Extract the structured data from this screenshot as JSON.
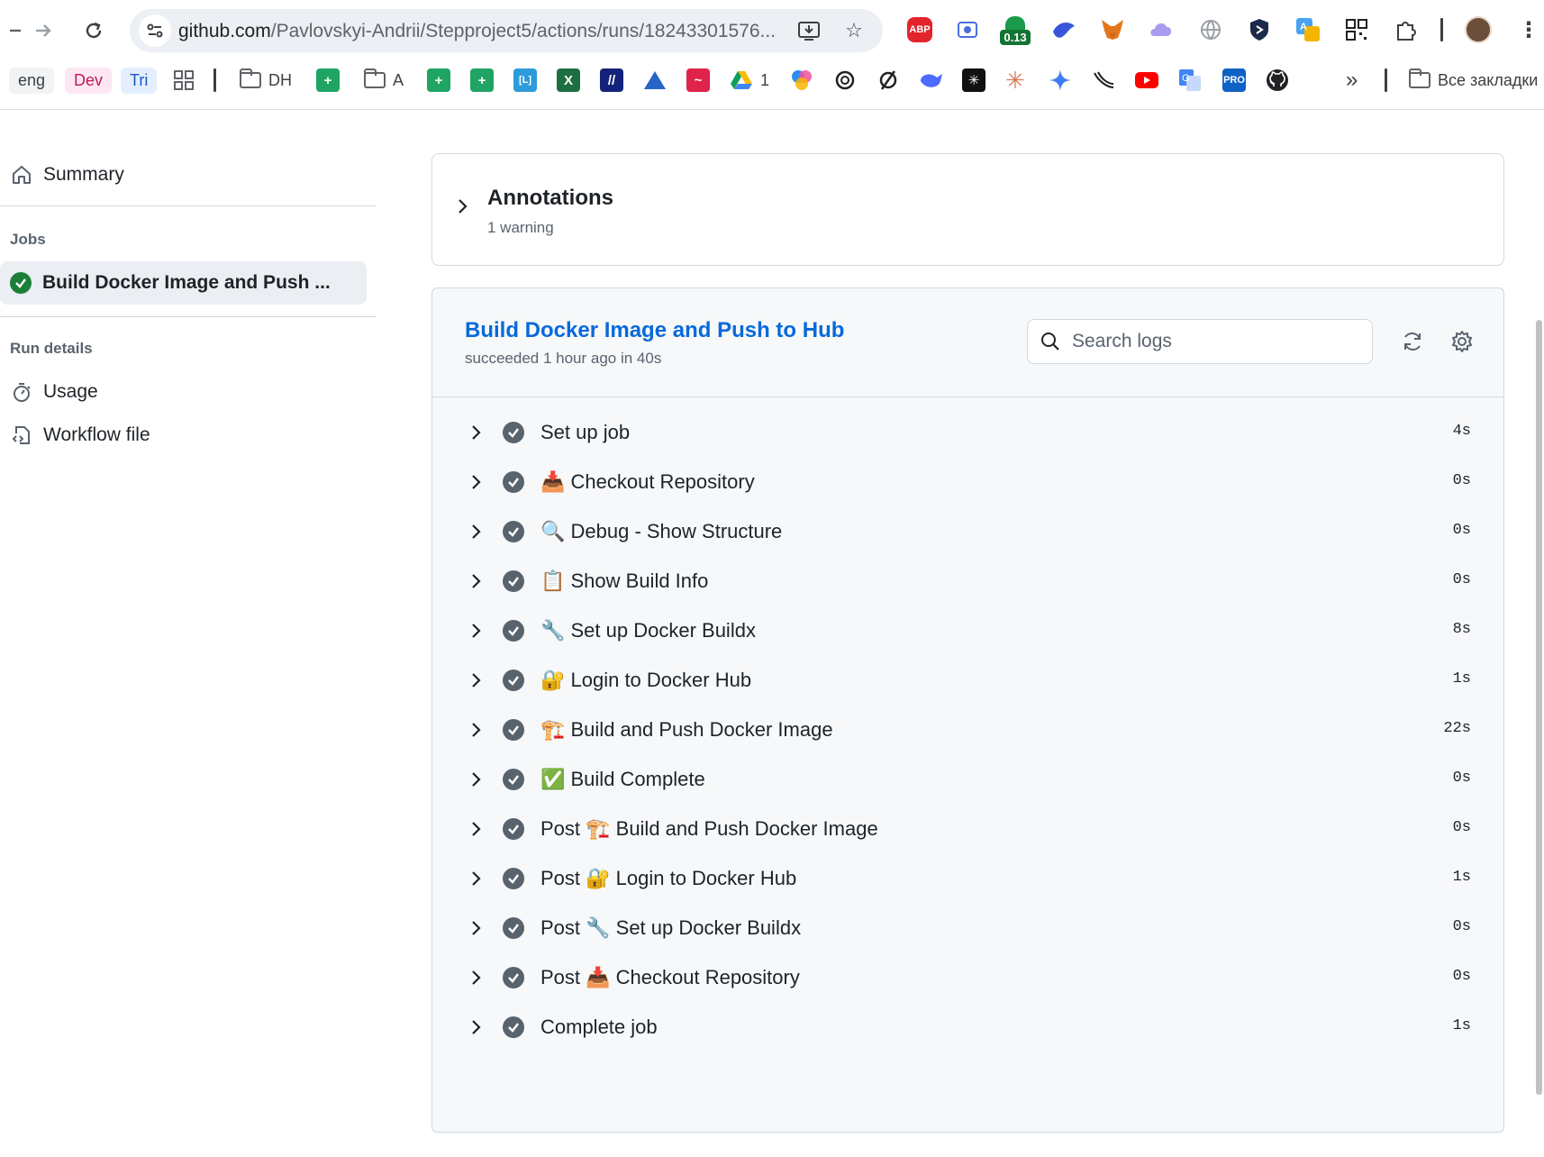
{
  "browser": {
    "url_host": "github.com",
    "url_path": "/Pavlovskyi-Andrii/Stepproject5/actions/runs/18243301576...",
    "extensions": [
      "abp-icon",
      "screen-capture-icon",
      "counter-badge-icon",
      "bird-icon",
      "metamask-fox-icon",
      "cloud-icon",
      "globe-icon",
      "shield-icon",
      "translate-icon",
      "qr-icon",
      "puzzle-icon"
    ],
    "ext_labels": {
      "abp": "ABP",
      "badge": "0.13"
    },
    "bookmarks": {
      "eng": "eng",
      "dev": "Dev",
      "tri": "Tri",
      "dh": "DH",
      "a": "A",
      "l": "[L]",
      "drive_count": "1",
      "pro": "PRO",
      "all_bookmarks": "Все закладки"
    }
  },
  "sidebar": {
    "summary": "Summary",
    "jobs_heading": "Jobs",
    "active_job": "Build Docker Image and Push ...",
    "run_details_heading": "Run details",
    "usage": "Usage",
    "workflow_file": "Workflow file"
  },
  "annotations": {
    "title": "Annotations",
    "subtitle": "1 warning"
  },
  "job": {
    "title": "Build Docker Image and Push to Hub",
    "subtitle": "succeeded 1 hour ago in 40s",
    "search_placeholder": "Search logs"
  },
  "steps": [
    {
      "name": "Set up job",
      "duration": "4s"
    },
    {
      "name": "📥 Checkout Repository",
      "duration": "0s"
    },
    {
      "name": "🔍 Debug - Show Structure",
      "duration": "0s"
    },
    {
      "name": "📋 Show Build Info",
      "duration": "0s"
    },
    {
      "name": "🔧 Set up Docker Buildx",
      "duration": "8s"
    },
    {
      "name": "🔐 Login to Docker Hub",
      "duration": "1s"
    },
    {
      "name": "🏗️ Build and Push Docker Image",
      "duration": "22s"
    },
    {
      "name": "✅ Build Complete",
      "duration": "0s"
    },
    {
      "name": "Post 🏗️ Build and Push Docker Image",
      "duration": "0s"
    },
    {
      "name": "Post 🔐 Login to Docker Hub",
      "duration": "1s"
    },
    {
      "name": "Post 🔧 Set up Docker Buildx",
      "duration": "0s"
    },
    {
      "name": "Post 📥 Checkout Repository",
      "duration": "0s"
    },
    {
      "name": "Complete job",
      "duration": "1s"
    }
  ],
  "colors": {
    "link": "#0969da",
    "success": "#1a7f37",
    "muted": "#59636e",
    "border": "#d1d9e0"
  }
}
